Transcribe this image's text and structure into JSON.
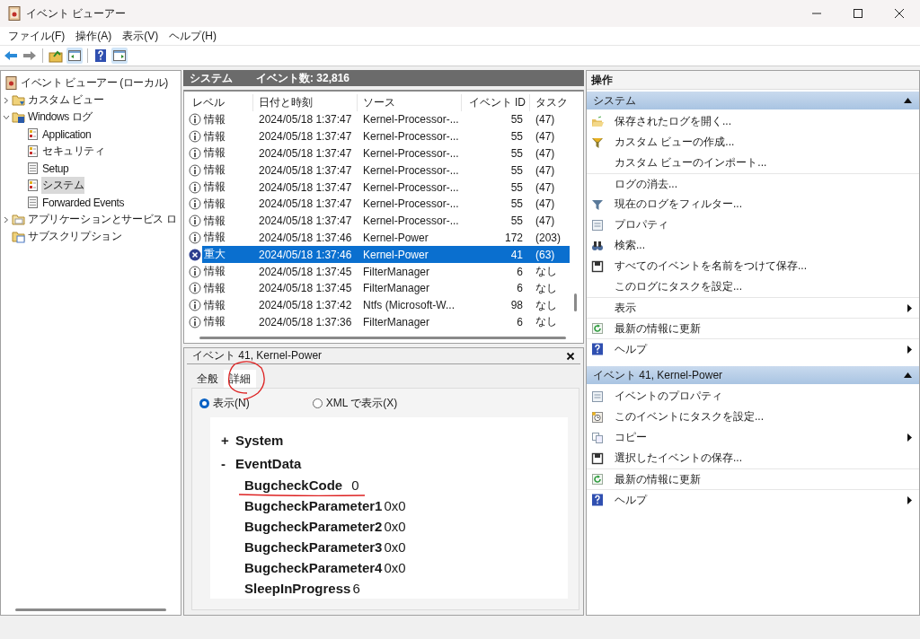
{
  "window": {
    "title": "イベント ビューアー"
  },
  "menu": [
    "ファイル(F)",
    "操作(A)",
    "表示(V)",
    "ヘルプ(H)"
  ],
  "tree": [
    {
      "label": "イベント ビューアー (ローカル)",
      "kind": "viewer",
      "children": [
        {
          "label": "カスタム ビュー",
          "kind": "folder",
          "expanded": false
        },
        {
          "label": "Windows ログ",
          "kind": "winfolder",
          "expanded": true,
          "children": [
            {
              "label": "Application",
              "kind": "log",
              "selected": false
            },
            {
              "label": "セキュリティ",
              "kind": "log",
              "selected": false
            },
            {
              "label": "Setup",
              "kind": "plainlog",
              "selected": false
            },
            {
              "label": "システム",
              "kind": "log",
              "selected": true
            },
            {
              "label": "Forwarded Events",
              "kind": "plainlog",
              "selected": false
            }
          ]
        },
        {
          "label": "アプリケーションとサービス ロ",
          "kind": "appfolder",
          "expanded": false
        },
        {
          "label": "サブスクリプション",
          "kind": "subscription"
        }
      ]
    }
  ],
  "log_header": {
    "name": "システム",
    "count": "イベント数: 32,816"
  },
  "table": {
    "columns": [
      "レベル",
      "日付と時刻",
      "ソース",
      "イベント ID",
      "タスク"
    ],
    "rows": [
      {
        "kind": "info",
        "level": "情報",
        "date": "2024/05/18 1:37:47",
        "source": "Kernel-Processor-...",
        "id": "55",
        "task": "(47)",
        "selected": false
      },
      {
        "kind": "info",
        "level": "情報",
        "date": "2024/05/18 1:37:47",
        "source": "Kernel-Processor-...",
        "id": "55",
        "task": "(47)",
        "selected": false
      },
      {
        "kind": "info",
        "level": "情報",
        "date": "2024/05/18 1:37:47",
        "source": "Kernel-Processor-...",
        "id": "55",
        "task": "(47)",
        "selected": false
      },
      {
        "kind": "info",
        "level": "情報",
        "date": "2024/05/18 1:37:47",
        "source": "Kernel-Processor-...",
        "id": "55",
        "task": "(47)",
        "selected": false
      },
      {
        "kind": "info",
        "level": "情報",
        "date": "2024/05/18 1:37:47",
        "source": "Kernel-Processor-...",
        "id": "55",
        "task": "(47)",
        "selected": false
      },
      {
        "kind": "info",
        "level": "情報",
        "date": "2024/05/18 1:37:47",
        "source": "Kernel-Processor-...",
        "id": "55",
        "task": "(47)",
        "selected": false
      },
      {
        "kind": "info",
        "level": "情報",
        "date": "2024/05/18 1:37:47",
        "source": "Kernel-Processor-...",
        "id": "55",
        "task": "(47)",
        "selected": false
      },
      {
        "kind": "info",
        "level": "情報",
        "date": "2024/05/18 1:37:46",
        "source": "Kernel-Power",
        "id": "172",
        "task": "(203)",
        "selected": false
      },
      {
        "kind": "critical",
        "level": "重大",
        "date": "2024/05/18 1:37:46",
        "source": "Kernel-Power",
        "id": "41",
        "task": "(63)",
        "selected": true
      },
      {
        "kind": "info",
        "level": "情報",
        "date": "2024/05/18 1:37:45",
        "source": "FilterManager",
        "id": "6",
        "task": "なし",
        "selected": false
      },
      {
        "kind": "info",
        "level": "情報",
        "date": "2024/05/18 1:37:45",
        "source": "FilterManager",
        "id": "6",
        "task": "なし",
        "selected": false
      },
      {
        "kind": "info",
        "level": "情報",
        "date": "2024/05/18 1:37:42",
        "source": "Ntfs (Microsoft-W...",
        "id": "98",
        "task": "なし",
        "selected": false
      },
      {
        "kind": "info",
        "level": "情報",
        "date": "2024/05/18 1:37:36",
        "source": "FilterManager",
        "id": "6",
        "task": "なし",
        "selected": false
      }
    ]
  },
  "detail": {
    "title": "イベント 41, Kernel-Power",
    "tabs": [
      {
        "label": "全般",
        "selected": false
      },
      {
        "label": "詳細",
        "selected": true
      }
    ],
    "views": [
      {
        "label": "表示(N)",
        "selected": true
      },
      {
        "label": "XML で表示(X)",
        "selected": false
      }
    ],
    "sections": [
      {
        "toggle": "+",
        "label": "System"
      },
      {
        "toggle": "-",
        "label": "EventData",
        "fields": [
          {
            "name": "BugcheckCode",
            "value": "0"
          },
          {
            "name": "BugcheckParameter1",
            "value": "0x0"
          },
          {
            "name": "BugcheckParameter2",
            "value": "0x0"
          },
          {
            "name": "BugcheckParameter3",
            "value": "0x0"
          },
          {
            "name": "BugcheckParameter4",
            "value": "0x0"
          },
          {
            "name": "SleepInProgress",
            "value": "6"
          }
        ]
      }
    ]
  },
  "actions": {
    "title": "操作",
    "sections": [
      {
        "title": "システム",
        "expanded": true,
        "items": [
          {
            "label": "保存されたログを開く...",
            "kind": "folder",
            "separator_before": false,
            "submenu": false
          },
          {
            "label": "カスタム ビューの作成...",
            "kind": "funnel-star",
            "separator_before": false,
            "submenu": false
          },
          {
            "label": "カスタム ビューのインポート...",
            "separator_before": false,
            "submenu": false
          },
          {
            "label": "ログの消去...",
            "separator_before": true,
            "submenu": false
          },
          {
            "label": "現在のログをフィルター...",
            "kind": "funnel",
            "separator_before": false,
            "submenu": false
          },
          {
            "label": "プロパティ",
            "kind": "properties",
            "separator_before": false,
            "submenu": false
          },
          {
            "label": "検索...",
            "kind": "binoculars",
            "separator_before": false,
            "submenu": false
          },
          {
            "label": "すべてのイベントを名前をつけて保存...",
            "kind": "save",
            "separator_before": false,
            "submenu": false
          },
          {
            "label": "このログにタスクを設定...",
            "separator_before": false,
            "submenu": false
          },
          {
            "label": "表示",
            "separator_before": true,
            "submenu": true
          },
          {
            "label": "最新の情報に更新",
            "kind": "refresh",
            "separator_before": true,
            "submenu": false
          },
          {
            "label": "ヘルプ",
            "kind": "help",
            "separator_before": true,
            "submenu": true
          }
        ]
      },
      {
        "title": "イベント 41, Kernel-Power",
        "expanded": true,
        "items": [
          {
            "label": "イベントのプロパティ",
            "kind": "properties",
            "separator_before": false,
            "submenu": false
          },
          {
            "label": "このイベントにタスクを設定...",
            "kind": "task",
            "separator_before": false,
            "submenu": false
          },
          {
            "label": "コピー",
            "kind": "copy",
            "separator_before": false,
            "submenu": true
          },
          {
            "label": "選択したイベントの保存...",
            "kind": "save",
            "separator_before": false,
            "submenu": false
          },
          {
            "label": "最新の情報に更新",
            "kind": "refresh",
            "separator_before": true,
            "submenu": false
          },
          {
            "label": "ヘルプ",
            "kind": "help",
            "separator_before": true,
            "submenu": true
          }
        ]
      }
    ]
  }
}
